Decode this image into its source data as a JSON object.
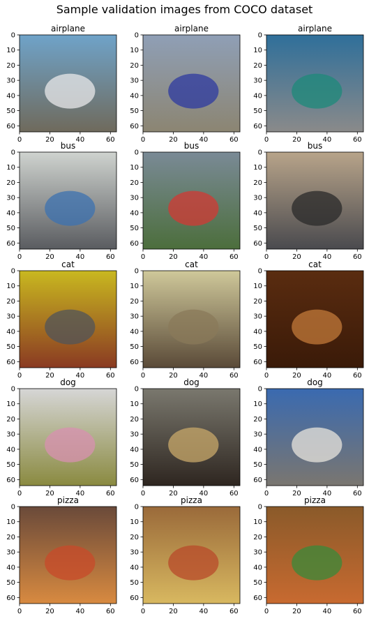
{
  "figure": {
    "title": "Sample validation images from COCO dataset"
  },
  "chart_data": {
    "type": "image_grid",
    "title": "Sample validation images from COCO dataset",
    "rows": 5,
    "cols": 3,
    "image_size": [
      64,
      64
    ],
    "xlim": [
      0,
      64
    ],
    "ylim": [
      64,
      0
    ],
    "xticks": [
      0,
      20,
      40,
      60
    ],
    "yticks": [
      0,
      10,
      20,
      30,
      40,
      50,
      60
    ],
    "xtick_labels": [
      "0",
      "20",
      "40",
      "60"
    ],
    "ytick_labels": [
      "0",
      "10",
      "20",
      "30",
      "40",
      "50",
      "60"
    ],
    "panels": [
      {
        "title": "airplane",
        "colors": {
          "top": "#6fa3c9",
          "bottom": "#6f6a5c",
          "accent": "#e8e8ea"
        }
      },
      {
        "title": "airplane",
        "colors": {
          "top": "#8f9fb6",
          "bottom": "#8c8572",
          "accent": "#2e3aa0"
        }
      },
      {
        "title": "airplane",
        "colors": {
          "top": "#2f6f9a",
          "bottom": "#8a8a8a",
          "accent": "#1e8a7a"
        }
      },
      {
        "title": "bus",
        "colors": {
          "top": "#cfd3cf",
          "bottom": "#5a5c60",
          "accent": "#3c72b0"
        }
      },
      {
        "title": "bus",
        "colors": {
          "top": "#7a8a96",
          "bottom": "#4c6e3c",
          "accent": "#d23a34"
        }
      },
      {
        "title": "bus",
        "colors": {
          "top": "#b8a48a",
          "bottom": "#4a4a4e",
          "accent": "#2a2a2a"
        }
      },
      {
        "title": "cat",
        "colors": {
          "top": "#c9b820",
          "bottom": "#8a3a22",
          "accent": "#50545a"
        }
      },
      {
        "title": "cat",
        "colors": {
          "top": "#cfc89a",
          "bottom": "#5a4a38",
          "accent": "#8a7a5a"
        }
      },
      {
        "title": "cat",
        "colors": {
          "top": "#5a2c10",
          "bottom": "#3a1a08",
          "accent": "#c27a3a"
        }
      },
      {
        "title": "dog",
        "colors": {
          "top": "#d6d6d6",
          "bottom": "#8a8a40",
          "accent": "#d890b0"
        }
      },
      {
        "title": "dog",
        "colors": {
          "top": "#7a786e",
          "bottom": "#2e2620",
          "accent": "#c8a86a"
        }
      },
      {
        "title": "dog",
        "colors": {
          "top": "#3a6ab0",
          "bottom": "#7a7670",
          "accent": "#e8e4dc"
        }
      },
      {
        "title": "pizza",
        "colors": {
          "top": "#6a4a3a",
          "bottom": "#d88a40",
          "accent": "#c84a2a"
        }
      },
      {
        "title": "pizza",
        "colors": {
          "top": "#9a6a3a",
          "bottom": "#d8b860",
          "accent": "#b84a2a"
        }
      },
      {
        "title": "pizza",
        "colors": {
          "top": "#8a5a2a",
          "bottom": "#c86a30",
          "accent": "#3a8a3a"
        }
      }
    ]
  }
}
